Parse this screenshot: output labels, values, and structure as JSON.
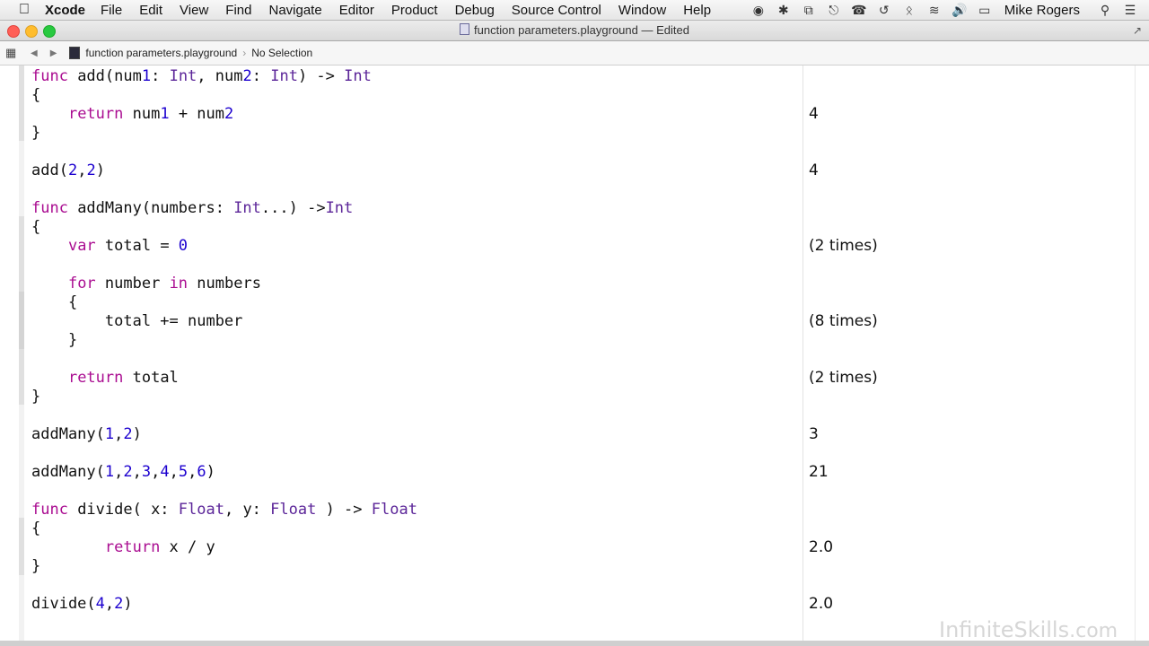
{
  "menubar": {
    "app_name": "Xcode",
    "items": [
      "File",
      "Edit",
      "View",
      "Find",
      "Navigate",
      "Editor",
      "Product",
      "Debug",
      "Source Control",
      "Window",
      "Help"
    ],
    "user": "Mike Rogers"
  },
  "window": {
    "title": "function parameters.playground — Edited"
  },
  "jumpbar": {
    "file": "function parameters.playground",
    "selection": "No Selection"
  },
  "code_lines": [
    "func add(num1: Int, num2: Int) -> Int",
    "{",
    "    return num1 + num2",
    "}",
    "add(2,2)",
    "func addMany(numbers: Int...) ->Int",
    "{",
    "    var total = 0",
    "    for number in numbers",
    "    {",
    "        total += number",
    "    }",
    "    return total",
    "}",
    "addMany(1,2)",
    "addMany(1,2,3,4,5,6)",
    "func divide( x: Float, y: Float ) -> Float",
    "{",
    "        return x / y",
    "}",
    "divide(4,2)"
  ],
  "results": [
    "4",
    "4",
    "(2 times)",
    "(8 times)",
    "(2 times)",
    "3",
    "21",
    "2.0",
    "2.0"
  ],
  "watermark": {
    "brand": "InfiniteSkills",
    "suffix": ".com"
  },
  "icons": {
    "apple": "apple-logo-icon",
    "search": "spotlight-search-icon",
    "list": "notification-list-icon"
  },
  "colors": {
    "keyword": "#aa0d91",
    "type": "#5c2699",
    "number": "#1c00cf"
  }
}
